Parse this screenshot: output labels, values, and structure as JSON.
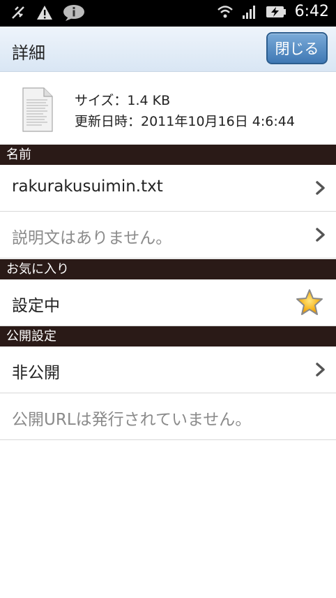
{
  "status_bar": {
    "time": "6:42",
    "icons": [
      "usb-debug-icon",
      "warning-icon",
      "chat-bubble-icon",
      "wifi-icon",
      "signal-icon",
      "battery-charging-icon"
    ]
  },
  "header": {
    "title": "詳細",
    "close_label": "閉じる"
  },
  "file_info": {
    "size_line": "サイズ：1.4 KB",
    "modified_line": "更新日時：2011年10月16日 4:6:44",
    "icon": "text-file-icon"
  },
  "sections": {
    "name": {
      "header": "名前",
      "filename": "rakurakusuimin.txt",
      "description": "説明文はありません。"
    },
    "favorite": {
      "header": "お気に入り",
      "value": "設定中",
      "icon": "star-icon"
    },
    "publish": {
      "header": "公開設定",
      "value": "非公開",
      "url_note": "公開URLは発行されていません。"
    }
  },
  "colors": {
    "section_bg": "#2a1a17",
    "button_blue": "#3f78b4",
    "header_bg": "#dfe9f5"
  }
}
